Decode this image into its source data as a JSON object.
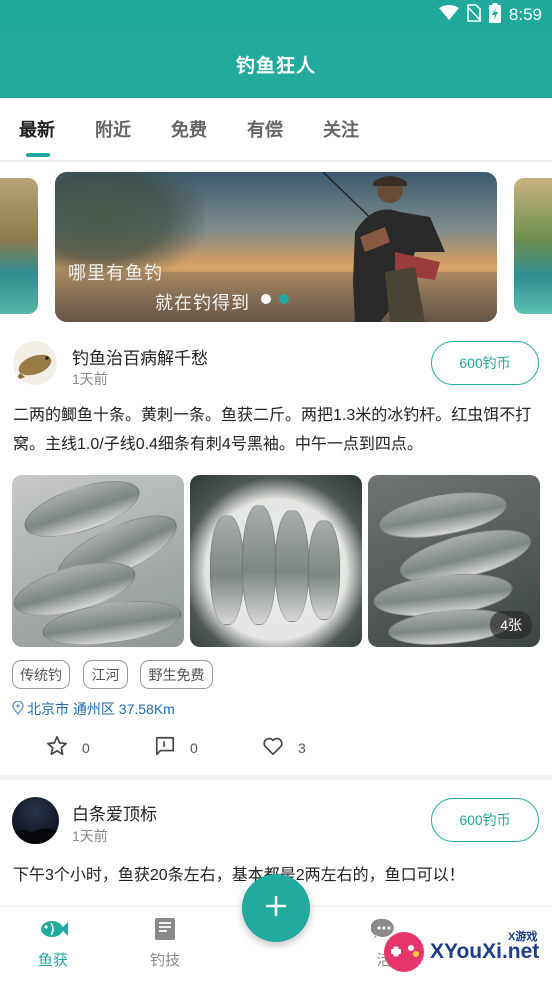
{
  "status_bar": {
    "time": "8:59",
    "icons": [
      "wifi-icon",
      "no-sim-icon",
      "battery-charging-icon"
    ]
  },
  "app_bar": {
    "title": "钓鱼狂人"
  },
  "tabs": [
    {
      "label": "最新",
      "active": true
    },
    {
      "label": "附近",
      "active": false
    },
    {
      "label": "免费",
      "active": false
    },
    {
      "label": "有偿",
      "active": false
    },
    {
      "label": "关注",
      "active": false
    }
  ],
  "banner": {
    "line1": "哪里有鱼钓",
    "line2": "就在钓得到",
    "slide_count": 2,
    "current_slide": 1
  },
  "posts": [
    {
      "author": "钓鱼治百病解千愁",
      "time": "1天前",
      "price": "600钓币",
      "content": "二两的鲫鱼十条。黄刺一条。鱼获二斤。两把1.3米的冰钓杆。红虫饵不打窝。主线1.0/子线0.4细条有刺4号黑袖。中午一点到四点。",
      "photo_count_label": "4张",
      "tags": [
        "传统钓",
        "江河",
        "野生免费"
      ],
      "location": "北京市 通州区 37.58Km",
      "stats": {
        "likes": "0",
        "comments": "0",
        "favorites": "3"
      }
    },
    {
      "author": "白条爱顶标",
      "time": "1天前",
      "price": "600钓币",
      "content": "下午3个小时，鱼获20条左右，基本都是2两左右的，鱼口可以！"
    }
  ],
  "fab": {
    "icon": "plus-icon"
  },
  "bottom_nav": [
    {
      "label": "鱼获",
      "icon": "fish-icon",
      "active": true
    },
    {
      "label": "钓技",
      "icon": "book-icon",
      "active": false
    },
    {
      "label": "活",
      "icon": "chat-icon",
      "active": false
    }
  ],
  "watermark": {
    "brand": "XYouXi.net",
    "cn": "X游戏"
  },
  "colors": {
    "accent": "#22aa9f",
    "location_blue": "#1f6ab0"
  }
}
